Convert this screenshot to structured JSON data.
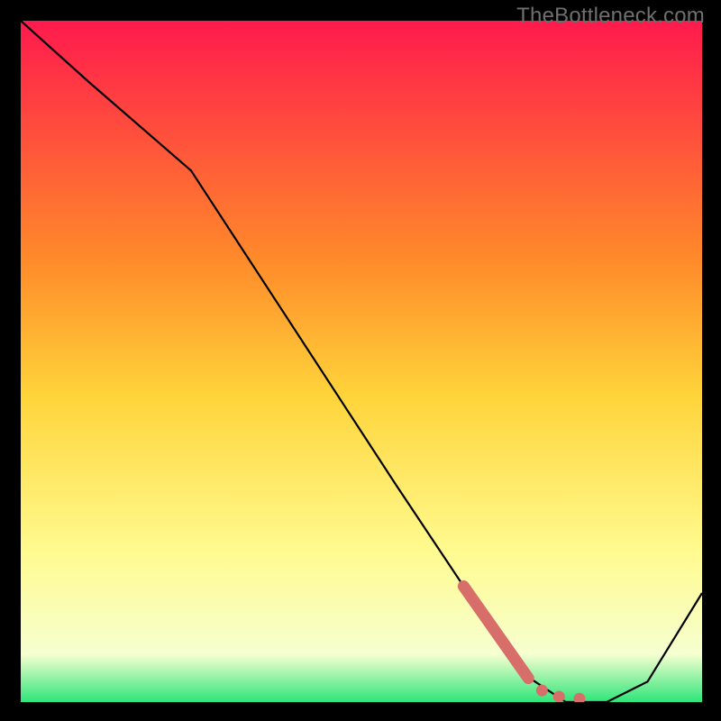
{
  "watermark": "TheBottleneck.com",
  "background_color": "#000000",
  "chart_data": {
    "type": "line",
    "title": "",
    "xlabel": "",
    "ylabel": "",
    "xlim": [
      0,
      100
    ],
    "ylim": [
      0,
      100
    ],
    "grid": false,
    "legend": false,
    "gradient_stops": [
      {
        "offset": 0,
        "color": "#ff1a4d"
      },
      {
        "offset": 35,
        "color": "#ff8a2a"
      },
      {
        "offset": 55,
        "color": "#ffd43a"
      },
      {
        "offset": 78,
        "color": "#fffb90"
      },
      {
        "offset": 93,
        "color": "#f6ffd0"
      },
      {
        "offset": 100,
        "color": "#2ee57a"
      }
    ],
    "curve": {
      "x": [
        0,
        10,
        25,
        40,
        55,
        65,
        74,
        80,
        86,
        92,
        100
      ],
      "y": [
        100,
        91,
        78,
        55,
        32,
        17,
        4,
        0,
        0,
        3,
        16
      ]
    },
    "highlight_segment": {
      "color": "#d86e6a",
      "thick": {
        "x": [
          65,
          74.5
        ],
        "y": [
          17,
          3.5
        ]
      },
      "dots": {
        "x": [
          76.5,
          79,
          82
        ],
        "y": [
          1.7,
          0.8,
          0.5
        ]
      }
    }
  }
}
